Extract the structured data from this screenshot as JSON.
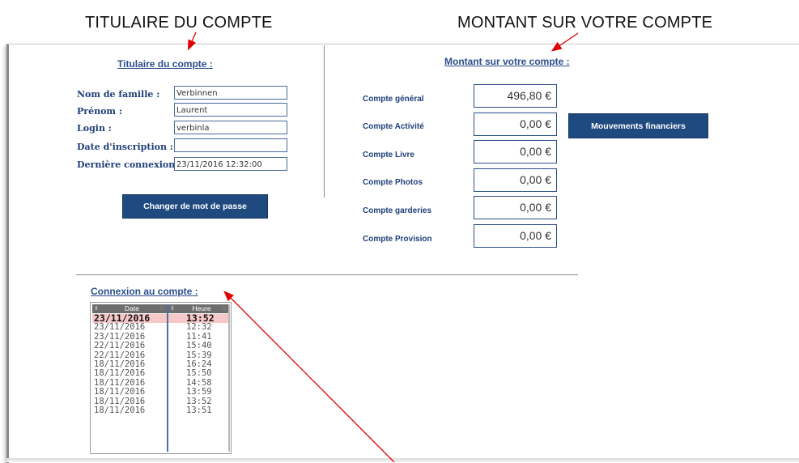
{
  "annotations": {
    "titulaire": "TITULAIRE DU COMPTE",
    "montant": "MONTANT SUR VOTRE COMPTE"
  },
  "holder": {
    "title": "Titulaire du compte :",
    "fields": [
      {
        "label": "Nom de famille :",
        "value": "Verbinnen"
      },
      {
        "label": "Prénom :",
        "value": "Laurent"
      },
      {
        "label": "Login :",
        "value": "verbinla"
      },
      {
        "label": "Date d'inscription :",
        "value": ""
      },
      {
        "label": "Dernière connexion :",
        "value": "23/11/2016 12:32:00"
      }
    ],
    "change_password_button": "Changer de mot de passe"
  },
  "balance": {
    "title": "Montant sur votre compte :",
    "accounts": [
      {
        "label": "Compte général",
        "amount": "496,80 €"
      },
      {
        "label": "Compte Activité",
        "amount": "0,00 €"
      },
      {
        "label": "Compte Livre",
        "amount": "0,00 €"
      },
      {
        "label": "Compte Photos",
        "amount": "0,00 €"
      },
      {
        "label": "Compte garderies",
        "amount": "0,00 €"
      },
      {
        "label": "Compte Provision",
        "amount": "0,00 €"
      }
    ],
    "movements_button": "Mouvements financiers"
  },
  "connections": {
    "title": "Connexion au compte :",
    "columns": [
      "Date",
      "Heure"
    ],
    "rows": [
      {
        "date": "23/11/2016",
        "time": "13:52",
        "selected": true
      },
      {
        "date": "23/11/2016",
        "time": "12:32"
      },
      {
        "date": "23/11/2016",
        "time": "11:41"
      },
      {
        "date": "22/11/2016",
        "time": "15:40"
      },
      {
        "date": "22/11/2016",
        "time": "15:39"
      },
      {
        "date": "18/11/2016",
        "time": "16:24"
      },
      {
        "date": "18/11/2016",
        "time": "15:50"
      },
      {
        "date": "18/11/2016",
        "time": "14:58"
      },
      {
        "date": "18/11/2016",
        "time": "13:59"
      },
      {
        "date": "18/11/2016",
        "time": "13:52"
      },
      {
        "date": "18/11/2016",
        "time": "13:51"
      }
    ]
  },
  "colors": {
    "accent": "#1f4a80",
    "label": "#1f3f7a",
    "arrow": "#e00000",
    "selected_row": "#f7c8c8"
  },
  "icons": [
    "sort-icon",
    "arrow-annotation"
  ]
}
